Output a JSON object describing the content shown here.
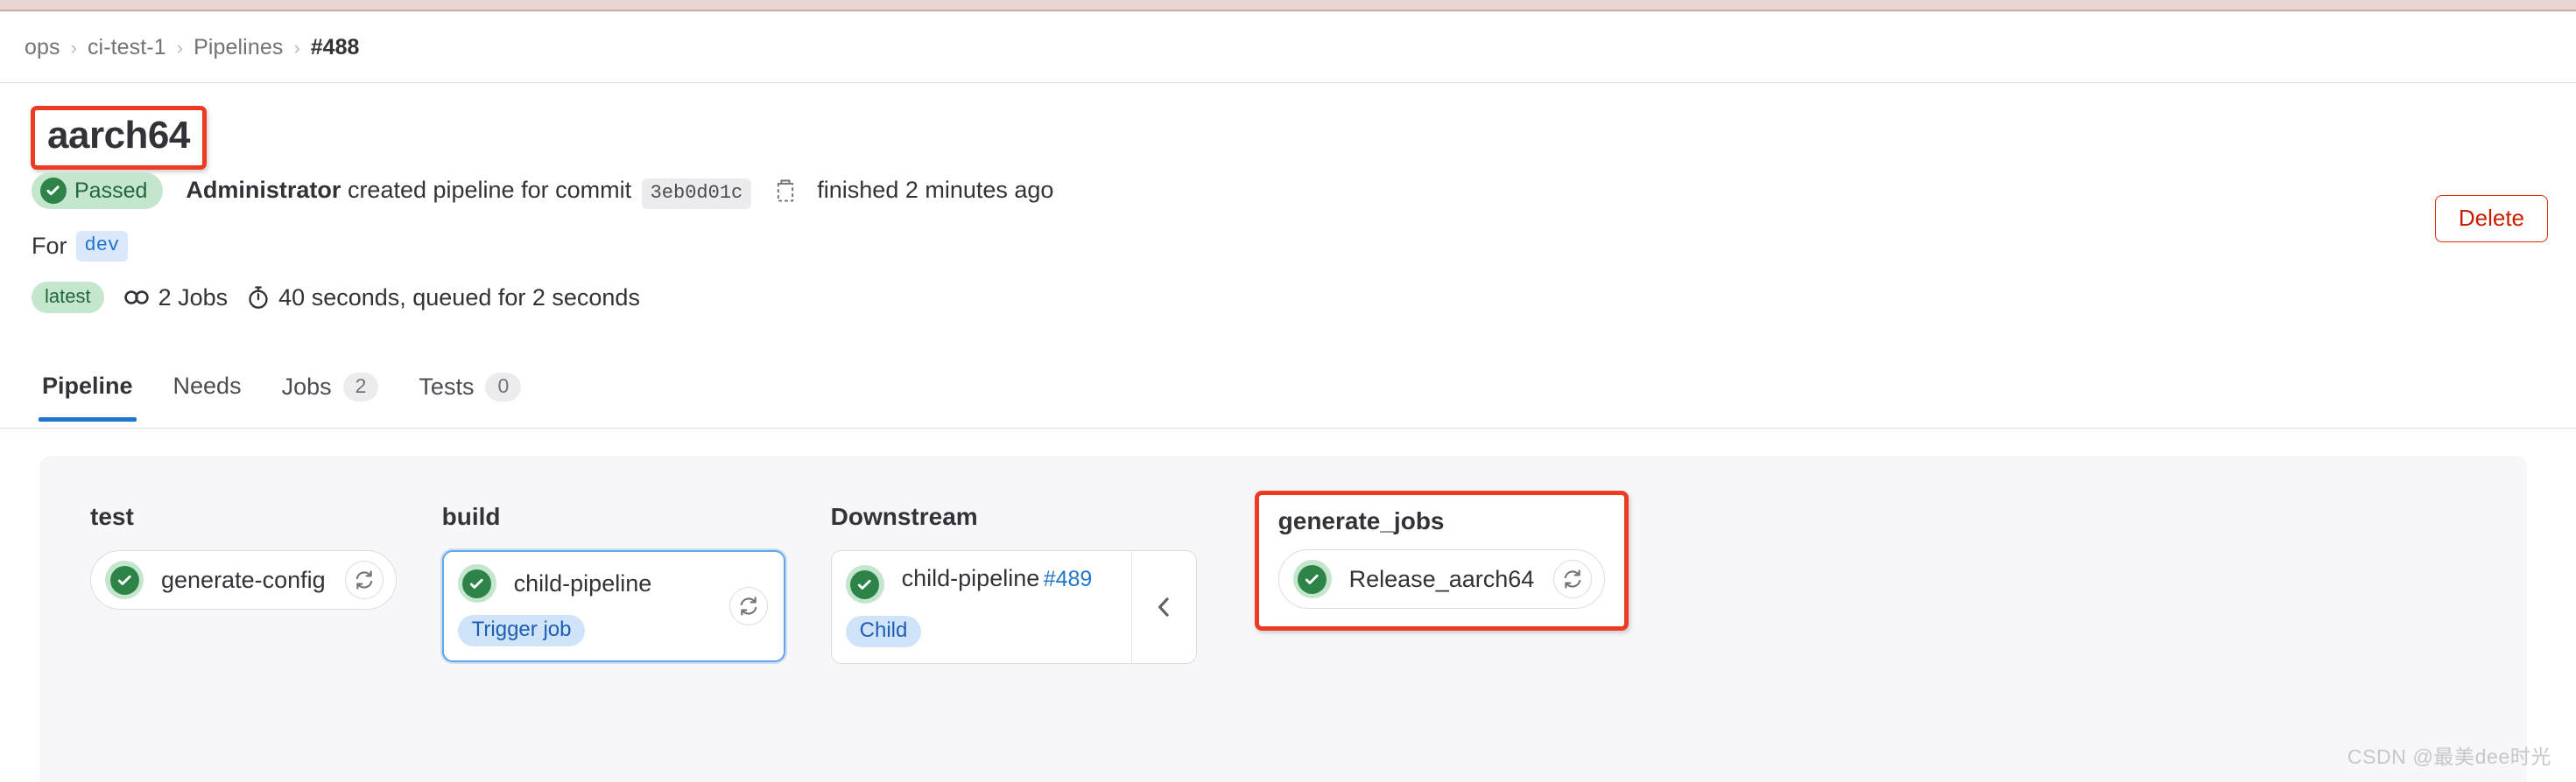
{
  "breadcrumb": {
    "items": [
      {
        "label": "ops",
        "current": false
      },
      {
        "label": "ci-test-1",
        "current": false
      },
      {
        "label": "Pipelines",
        "current": false
      },
      {
        "label": "#488",
        "current": true
      }
    ],
    "separator": "›"
  },
  "header": {
    "title": "aarch64",
    "delete_label": "Delete",
    "status": {
      "badge_label": "Passed",
      "actor": "Administrator",
      "action_text": "created pipeline for commit",
      "commit_sha": "3eb0d01c",
      "copy_icon": "copy-to-clipboard-icon",
      "finished_text": "finished 2 minutes ago"
    },
    "for_row": {
      "label": "For",
      "ref": "dev"
    },
    "meta": {
      "latest_badge": "latest",
      "jobs_icon": "pipeline-link-icon",
      "jobs_text": "2 Jobs",
      "duration_icon": "timer-icon",
      "duration_text": "40 seconds, queued for 2 seconds"
    }
  },
  "tabs": [
    {
      "label": "Pipeline",
      "count": null,
      "active": true
    },
    {
      "label": "Needs",
      "count": null,
      "active": false
    },
    {
      "label": "Jobs",
      "count": "2",
      "active": false
    },
    {
      "label": "Tests",
      "count": "0",
      "active": false
    }
  ],
  "graph": {
    "stages": [
      {
        "name": "test",
        "kind": "pill",
        "annotated": false,
        "jobs": [
          {
            "name": "generate-config",
            "status": "passed",
            "status_icon": "status-success-icon",
            "retry_icon": "retry-icon",
            "tag": null
          }
        ]
      },
      {
        "name": "build",
        "kind": "card",
        "annotated": false,
        "jobs": [
          {
            "name": "child-pipeline",
            "status": "passed",
            "status_icon": "status-success-icon",
            "retry_icon": "retry-icon",
            "tag": "Trigger job"
          }
        ]
      },
      {
        "name": "Downstream",
        "kind": "downstream",
        "annotated": false,
        "jobs": [
          {
            "name": "child-pipeline",
            "pipeline_id": "#489",
            "status": "passed",
            "status_icon": "status-success-icon",
            "tag": "Child",
            "collapse_icon": "chevron-left-icon"
          }
        ]
      },
      {
        "name": "generate_jobs",
        "kind": "pill",
        "annotated": true,
        "jobs": [
          {
            "name": "Release_aarch64",
            "status": "passed",
            "status_icon": "status-success-icon",
            "retry_icon": "retry-icon",
            "tag": null
          }
        ]
      }
    ]
  },
  "watermark": "CSDN @最美dee时光",
  "colors": {
    "success_green": "#2d8348",
    "success_bg": "#c3e6cd",
    "link_blue": "#1f75cb",
    "accent_blue": "#63a6e9",
    "danger_red": "#dd2b0e",
    "annotation_red": "#ef3a23",
    "graph_bg": "#f7f7fa"
  }
}
